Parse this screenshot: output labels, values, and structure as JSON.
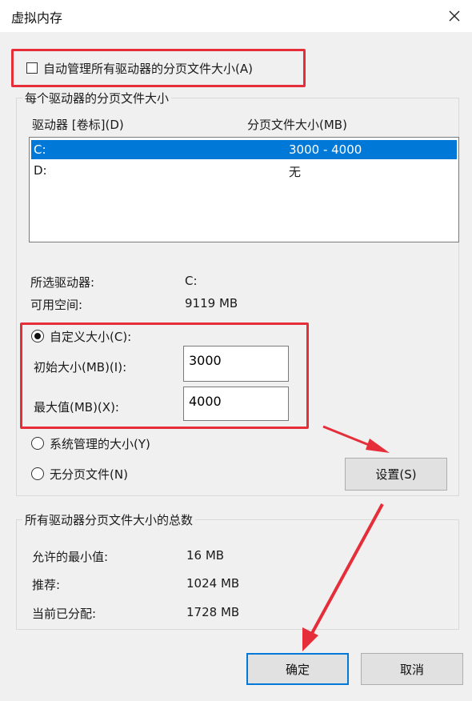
{
  "window": {
    "title": "虚拟内存"
  },
  "auto_manage": {
    "label": "自动管理所有驱动器的分页文件大小(A)",
    "checked": false
  },
  "per_drive": {
    "group_title": "每个驱动器的分页文件大小",
    "columns": {
      "drive": "驱动器 [卷标](D)",
      "size": "分页文件大小(MB)"
    },
    "drives": [
      {
        "drive": "C:",
        "size": "3000 - 4000",
        "selected": true
      },
      {
        "drive": "D:",
        "size": "无",
        "selected": false
      }
    ],
    "selected_drive_label": "所选驱动器:",
    "selected_drive_value": "C:",
    "free_space_label": "可用空间:",
    "free_space_value": "9119 MB",
    "custom_size": {
      "label": "自定义大小(C):",
      "selected": true
    },
    "initial_size": {
      "label": "初始大小(MB)(I):",
      "value": "3000"
    },
    "max_size": {
      "label": "最大值(MB)(X):",
      "value": "4000"
    },
    "system_managed": {
      "label": "系统管理的大小(Y)",
      "selected": false
    },
    "no_paging": {
      "label": "无分页文件(N)",
      "selected": false
    },
    "set_button": "设置(S)"
  },
  "totals": {
    "group_title": "所有驱动器分页文件大小的总数",
    "min_label": "允许的最小值:",
    "min_value": "16 MB",
    "recommended_label": "推荐:",
    "recommended_value": "1024 MB",
    "allocated_label": "当前已分配:",
    "allocated_value": "1728 MB"
  },
  "buttons": {
    "ok": "确定",
    "cancel": "取消"
  },
  "colors": {
    "annotation_red": "#e52e3a",
    "selection_blue": "#0078d7"
  }
}
